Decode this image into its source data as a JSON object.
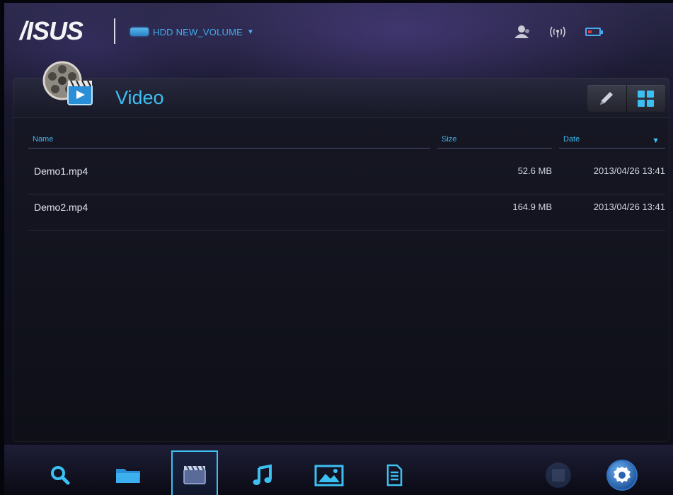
{
  "header": {
    "logo": "/ISUS",
    "volume_label": "HDD NEW_VOLUME",
    "volume_caret": "▼",
    "status_icons": [
      "user-icon",
      "wireless-icon",
      "battery-icon"
    ],
    "battery_level": 0.35
  },
  "panel": {
    "title": "Video",
    "tools": [
      "edit-icon",
      "grid-view-icon"
    ]
  },
  "table": {
    "columns": {
      "name": "Name",
      "size": "Size",
      "date": "Date"
    },
    "sort_caret": "▼",
    "rows": [
      {
        "name": "Demo1.mp4",
        "size": "52.6 MB",
        "date": "2013/04/26 13:41"
      },
      {
        "name": "Demo2.mp4",
        "size": "164.9 MB",
        "date": "2013/04/26 13:41"
      }
    ]
  },
  "bottom_nav": {
    "items": [
      "search-icon",
      "folder-icon",
      "video-icon",
      "music-icon",
      "photo-icon",
      "document-icon",
      "save-icon",
      "settings-icon"
    ],
    "active": "video-icon"
  },
  "colors": {
    "accent": "#3cc0f2",
    "background": "#0c0d17",
    "battery_low": "#e03a3a"
  }
}
